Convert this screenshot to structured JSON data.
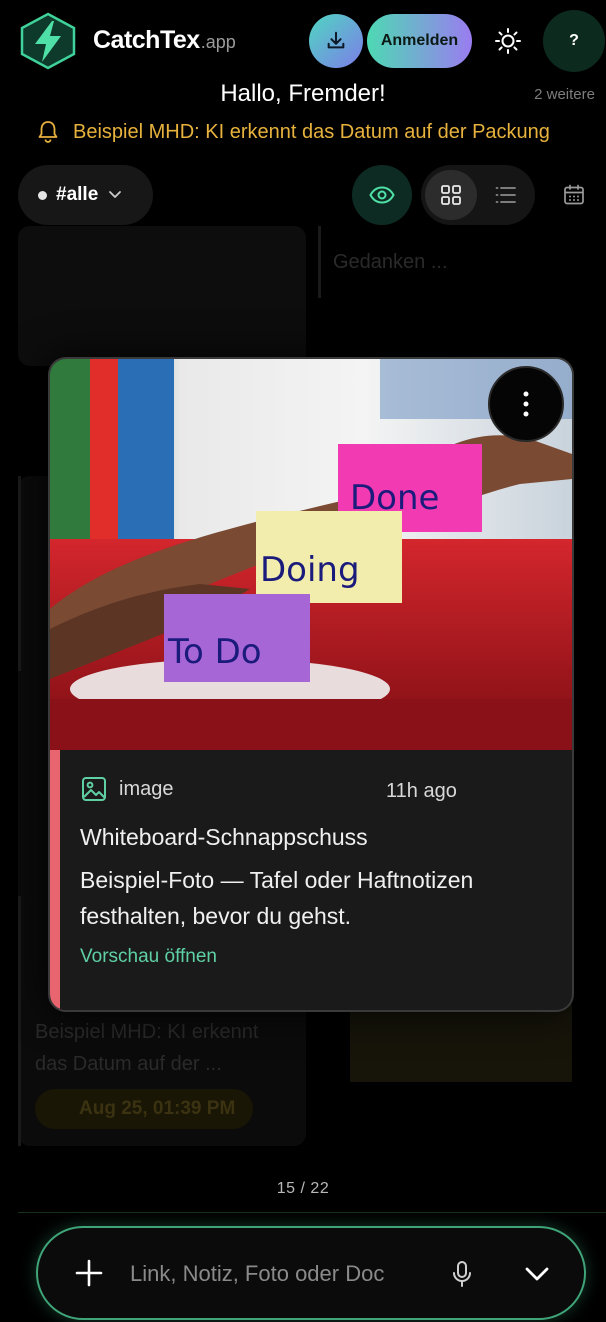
{
  "header": {
    "brand_main": "CatchTex",
    "brand_suffix": ".app",
    "login_label": "Anmelden",
    "help_label": "?",
    "download_icon": "download-icon",
    "theme_icon": "sun-icon"
  },
  "greeting": {
    "text": "Hallo, Fremder!",
    "more": "2 weitere"
  },
  "reminder": {
    "icon": "bell-icon",
    "text": "Beispiel MHD: KI erkennt das Datum auf der Packung",
    "color": "#e7b23d"
  },
  "filters": {
    "tag_label": "#alle",
    "view_modes": [
      "grid",
      "list"
    ],
    "active_view": "grid"
  },
  "background_cards": {
    "snippet_1": "Gedanken ...",
    "snippet_2_line_1": "Beispiel MHD: KI erkennt",
    "snippet_2_line_2": "das Datum auf der ...",
    "reminder_chip": "Aug 25, 01:39 PM"
  },
  "preview": {
    "type_label": "image",
    "time_label": "11h ago",
    "title": "Whiteboard-Schnappschuss",
    "description": "Beispiel-Foto — Tafel oder Haftnotizen festhalten, bevor du gehst.",
    "link_label": "Vorschau öffnen",
    "accent_color": "#e8646f",
    "notes": {
      "note_1": "Done",
      "note_2": "Doing",
      "note_3": "To Do"
    }
  },
  "pager": {
    "text": "15 / 22"
  },
  "composer": {
    "placeholder": "Link, Notiz, Foto oder Doc",
    "accent_color": "#3fa579"
  }
}
